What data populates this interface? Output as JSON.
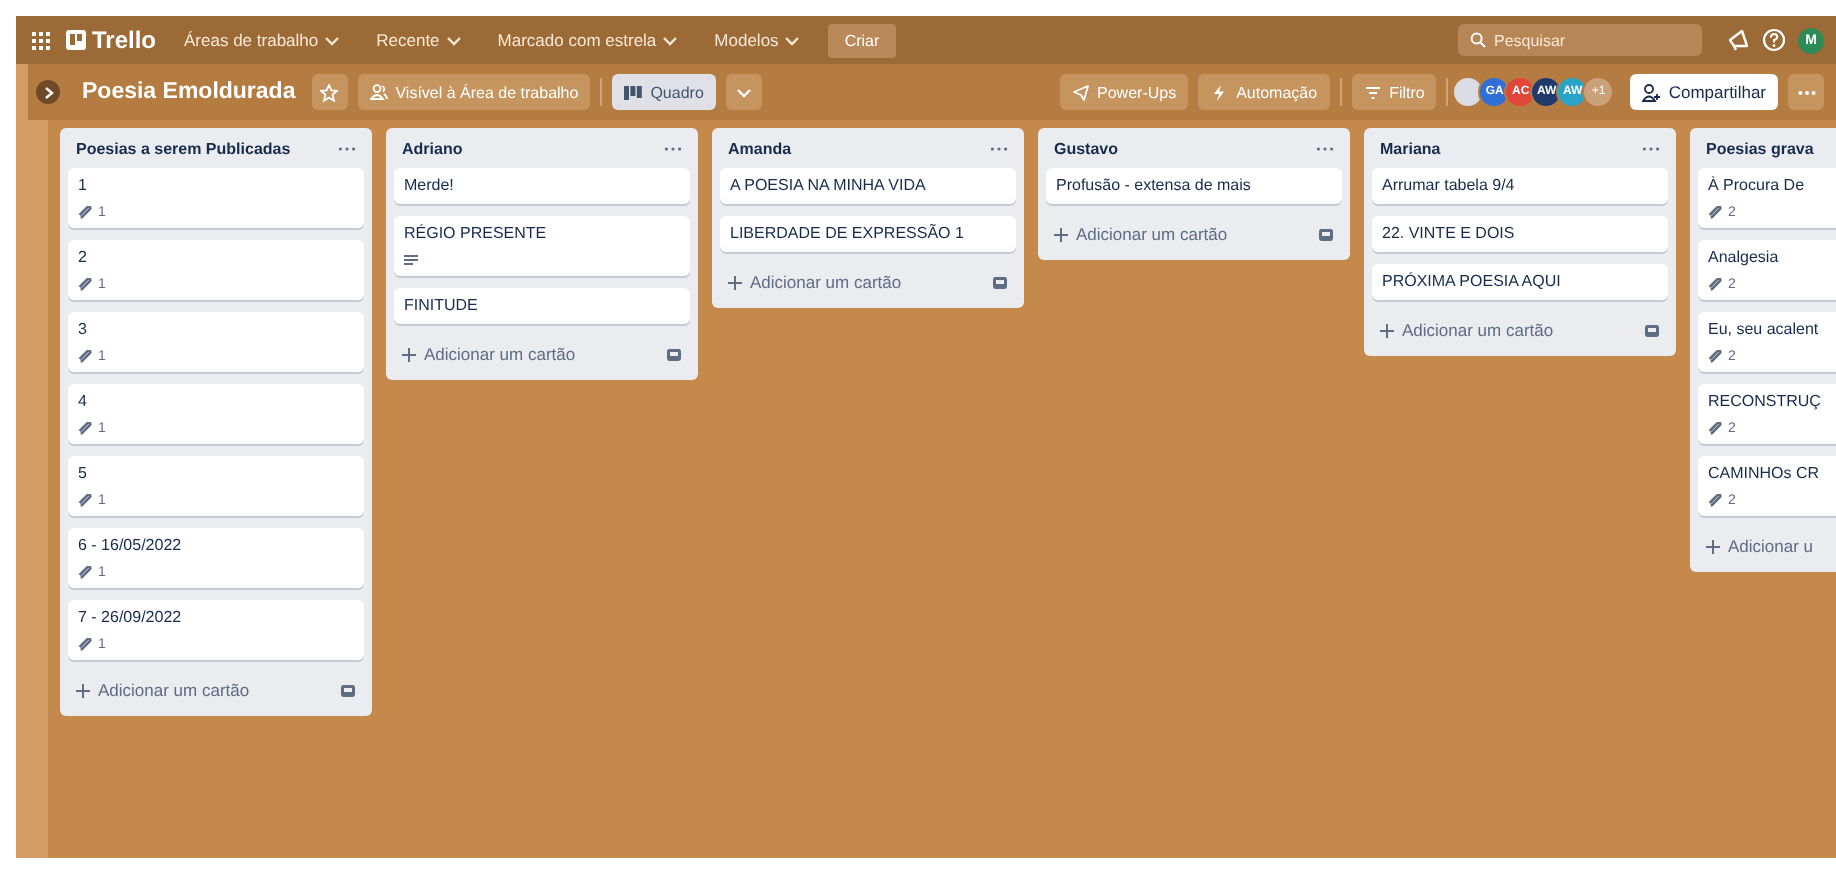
{
  "topbar": {
    "logo": "Trello",
    "menus": [
      {
        "label": "Áreas de trabalho"
      },
      {
        "label": "Recente"
      },
      {
        "label": "Marcado com estrela"
      },
      {
        "label": "Modelos"
      }
    ],
    "create": "Criar",
    "search": {
      "placeholder": "Pesquisar"
    },
    "user_avatar": "M"
  },
  "board": {
    "title": "Poesia Emoldurada",
    "starred": false,
    "visibility": "Visível à Área de trabalho",
    "view": {
      "label": "Quadro",
      "selected": true
    },
    "actions": [
      {
        "kind": "powerups",
        "label": "Power-Ups"
      },
      {
        "kind": "automation",
        "label": "Automação"
      },
      {
        "kind": "filter",
        "label": "Filtro"
      }
    ],
    "members": [
      {
        "color": "#d9dde3"
      },
      {
        "initials": "GA",
        "color": "#2f6fd6"
      },
      {
        "initials": "AC",
        "color": "#e0463a"
      },
      {
        "initials": "AW",
        "color": "#1f3a6b"
      },
      {
        "initials": "AW",
        "color": "#2aa3c9"
      }
    ],
    "more_members": "+1",
    "share": "Compartilhar"
  },
  "lists": [
    {
      "title": "Poesias a serem Publicadas",
      "cards": [
        {
          "title": "1",
          "badges": [
            {
              "kind": "attachment",
              "count": "1"
            }
          ]
        },
        {
          "title": "2",
          "badges": [
            {
              "kind": "attachment",
              "count": "1"
            }
          ]
        },
        {
          "title": "3",
          "badges": [
            {
              "kind": "attachment",
              "count": "1"
            }
          ]
        },
        {
          "title": "4",
          "badges": [
            {
              "kind": "attachment",
              "count": "1"
            }
          ]
        },
        {
          "title": "5",
          "badges": [
            {
              "kind": "attachment",
              "count": "1"
            }
          ]
        },
        {
          "title": "6 - 16/05/2022",
          "badges": [
            {
              "kind": "attachment",
              "count": "1"
            }
          ]
        },
        {
          "title": "7 - 26/09/2022",
          "badges": [
            {
              "kind": "attachment",
              "count": "1"
            }
          ]
        }
      ],
      "add_card": "Adicionar um cartão"
    },
    {
      "title": "Adriano",
      "cards": [
        {
          "title": "Merde!"
        },
        {
          "title": "RÉGIO PRESENTE",
          "badges": [
            {
              "kind": "description"
            }
          ]
        },
        {
          "title": "FINITUDE"
        }
      ],
      "add_card": "Adicionar um cartão"
    },
    {
      "title": "Amanda",
      "cards": [
        {
          "title": "A POESIA NA MINHA VIDA"
        },
        {
          "title": "LIBERDADE DE EXPRESSÃO 1"
        }
      ],
      "add_card": "Adicionar um cartão"
    },
    {
      "title": "Gustavo",
      "cards": [
        {
          "title": "Profusão - extensa de mais"
        }
      ],
      "add_card": "Adicionar um cartão"
    },
    {
      "title": "Mariana",
      "cards": [
        {
          "title": "Arrumar tabela 9/4"
        },
        {
          "title": "22. VINTE E DOIS"
        },
        {
          "title": "PRÓXIMA POESIA AQUI"
        }
      ],
      "add_card": "Adicionar um cartão"
    },
    {
      "title": "Poesias grava",
      "cards": [
        {
          "title": "À Procura De",
          "badges": [
            {
              "kind": "attachment",
              "count": "2"
            }
          ]
        },
        {
          "title": "Analgesia",
          "badges": [
            {
              "kind": "attachment",
              "count": "2"
            }
          ]
        },
        {
          "title": "Eu, seu acalent",
          "badges": [
            {
              "kind": "attachment",
              "count": "2"
            }
          ]
        },
        {
          "title": "RECONSTRUÇ",
          "badges": [
            {
              "kind": "attachment",
              "count": "2"
            }
          ]
        },
        {
          "title": "CAMINHOs CR",
          "badges": [
            {
              "kind": "attachment",
              "count": "2"
            }
          ]
        }
      ],
      "add_card": "Adicionar u"
    }
  ]
}
